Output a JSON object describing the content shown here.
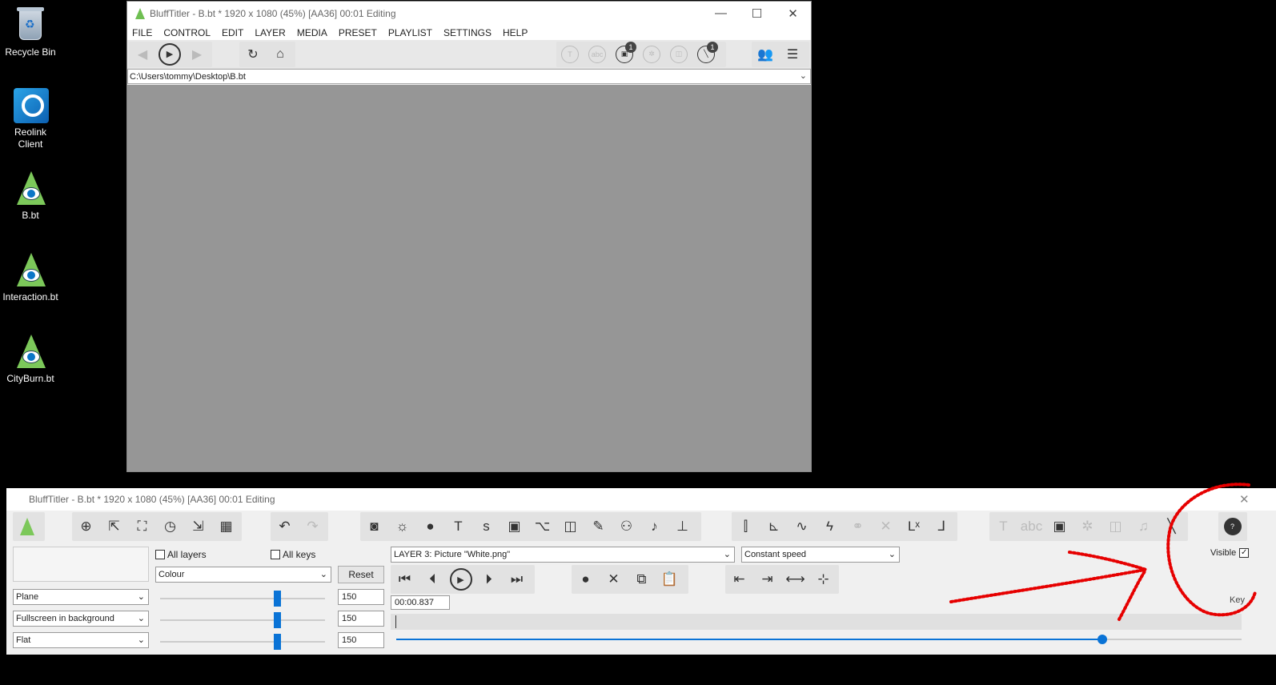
{
  "desktop": {
    "icons": [
      {
        "label": "Recycle Bin",
        "icon": "recycle-bin-icon"
      },
      {
        "label": "Reolink Client",
        "icon": "reolink-icon"
      },
      {
        "label": "B.bt",
        "icon": "blufftitler-file-icon"
      },
      {
        "label": "Interaction.bt",
        "icon": "blufftitler-file-icon"
      },
      {
        "label": "CityBurn.bt",
        "icon": "blufftitler-file-icon"
      }
    ]
  },
  "top_window": {
    "title": "BluffTitler - B.bt * 1920 x 1080 (45%) [AA36] 00:01 Editing",
    "menu": [
      "FILE",
      "CONTROL",
      "EDIT",
      "LAYER",
      "MEDIA",
      "PRESET",
      "PLAYLIST",
      "SETTINGS",
      "HELP"
    ],
    "controls": {
      "minimize": "—",
      "maximize": "☐",
      "close": "✕"
    },
    "path": "C:\\Users\\tommy\\Desktop\\B.bt",
    "badges": {
      "media": "1",
      "tools": "1"
    }
  },
  "bottom_window": {
    "title": "BluffTitler - B.bt * 1920 x 1080 (45%) [AA36] 00:01 Editing",
    "all_layers_label": "All layers",
    "all_keys_label": "All keys",
    "property_select": "Colour",
    "reset_label": "Reset",
    "shape_selects": [
      "Plane",
      "Fullscreen in background",
      "Flat"
    ],
    "slider_values": [
      "150",
      "150",
      "150"
    ],
    "slider_levels": [
      0.72,
      0.72,
      0.72
    ],
    "layer_select": "LAYER 3: Picture \"White.png\"",
    "speed_select": "Constant speed",
    "time_value": "00:00.837",
    "time_level": 0.835,
    "visible_label": "Visible",
    "visible_checked": "✓",
    "key_label": "Key",
    "close": "✕"
  },
  "colors": {
    "accent": "#0a73d6",
    "annotation": "#e60000",
    "canvas": "#969696"
  }
}
